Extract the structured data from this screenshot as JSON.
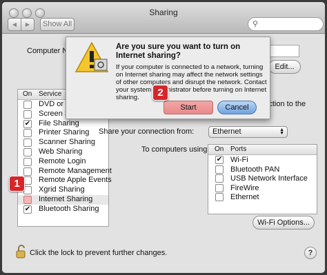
{
  "window": {
    "title": "Sharing"
  },
  "toolbar": {
    "back": "◀",
    "forward": "▶",
    "show_all": "Show All",
    "search_placeholder": ""
  },
  "computer_name": {
    "label": "Computer N",
    "edit_button": "Edit..."
  },
  "services": {
    "header_on": "On",
    "header_service": "Service",
    "items": [
      {
        "label": "DVD or CD",
        "checked": false
      },
      {
        "label": "Screen Sharing",
        "checked": false
      },
      {
        "label": "File Sharing",
        "checked": true
      },
      {
        "label": "Printer Sharing",
        "checked": false
      },
      {
        "label": "Scanner Sharing",
        "checked": false
      },
      {
        "label": "Web Sharing",
        "checked": false
      },
      {
        "label": "Remote Login",
        "checked": false
      },
      {
        "label": "Remote Management",
        "checked": false
      },
      {
        "label": "Remote Apple Events",
        "checked": false
      },
      {
        "label": "Xgrid Sharing",
        "checked": false
      },
      {
        "label": "Internet Sharing",
        "checked": false
      },
      {
        "label": "Bluetooth Sharing",
        "checked": true
      }
    ]
  },
  "right_panel": {
    "partial_text": "nnection to the",
    "share_from_label": "Share your connection from:",
    "share_from_value": "Ethernet",
    "to_computers_label": "To computers using:",
    "ports_header_on": "On",
    "ports_header_ports": "Ports",
    "ports": [
      {
        "label": "Wi-Fi",
        "checked": true
      },
      {
        "label": "Bluetooth PAN",
        "checked": false
      },
      {
        "label": "USB Network Interface",
        "checked": false
      },
      {
        "label": "FireWire",
        "checked": false
      },
      {
        "label": "Ethernet",
        "checked": false
      }
    ],
    "wifi_options_button": "Wi-Fi Options..."
  },
  "dialog": {
    "title": "Are you sure you want to turn on Internet sharing?",
    "message": "If your computer is connected to a network, turning on Internet sharing may affect the network settings of other computers and disrupt the network. Contact your system administrator before turning on Internet sharing.",
    "start_button": "Start",
    "cancel_button": "Cancel"
  },
  "annotations": {
    "step1": "1",
    "step2": "2",
    "badge_color": "#d7262b"
  },
  "footer": {
    "lock_text": "Click the lock to prevent further changes.",
    "help": "?"
  },
  "icons": [
    "warning-icon",
    "lock-icon",
    "search-icon",
    "help-icon",
    "chevron-updown-icon"
  ]
}
